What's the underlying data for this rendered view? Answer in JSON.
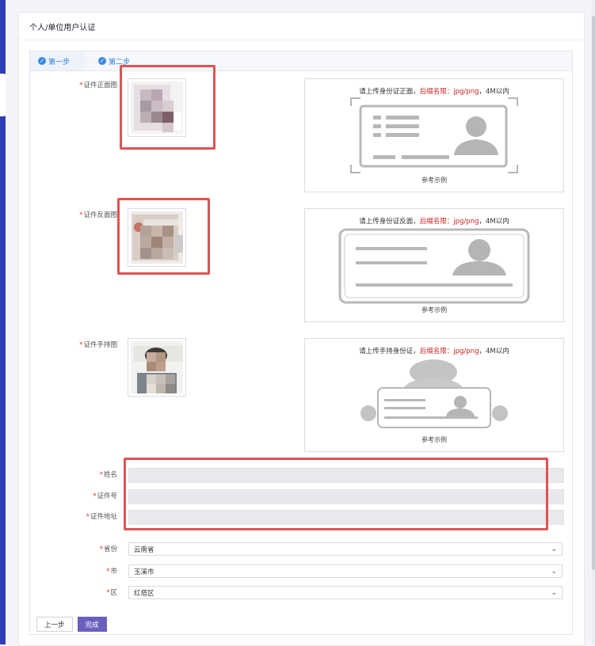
{
  "page": {
    "title": "个人/单位用户认证"
  },
  "steps": [
    {
      "label": "第一步"
    },
    {
      "label": "第二步"
    }
  ],
  "uploads": {
    "front": {
      "label": "证件正面图",
      "hint_prefix": "请上传身份证正面，",
      "hint_warn": "后缀名限：",
      "hint_fmt": "jpg/png",
      "hint_suffix": "，4M以内",
      "caption": "参考示例"
    },
    "back": {
      "label": "证件反面图",
      "hint_prefix": "请上传身份证反面，",
      "hint_warn": "后缀名限：",
      "hint_fmt": "jpg/png",
      "hint_suffix": "，4M以内",
      "caption": "参考示例"
    },
    "hold": {
      "label": "证件手持图",
      "hint_prefix": "请上传手持身份证，",
      "hint_warn": "后缀名限：",
      "hint_fmt": "jpg/png",
      "hint_suffix": "，4M以内",
      "caption": "参考示例"
    }
  },
  "fields": {
    "name": {
      "label": "姓名",
      "value": ""
    },
    "id_number": {
      "label": "证件号",
      "value": ""
    },
    "address": {
      "label": "证件地址",
      "value": ""
    }
  },
  "selects": {
    "province": {
      "label": "省份",
      "value": "云南省"
    },
    "city": {
      "label": "市",
      "value": "玉溪市"
    },
    "district": {
      "label": "区",
      "value": "红塔区"
    }
  },
  "buttons": {
    "prev": "上一步",
    "done": "完成"
  },
  "colors": {
    "accent": "#2f7fd6",
    "primary_button": "#6b5fbd",
    "highlight": "#e05252",
    "warning": "#c22222"
  },
  "icons": {
    "step_check": "check-circle-icon",
    "dropdown": "chevron-down-icon"
  }
}
